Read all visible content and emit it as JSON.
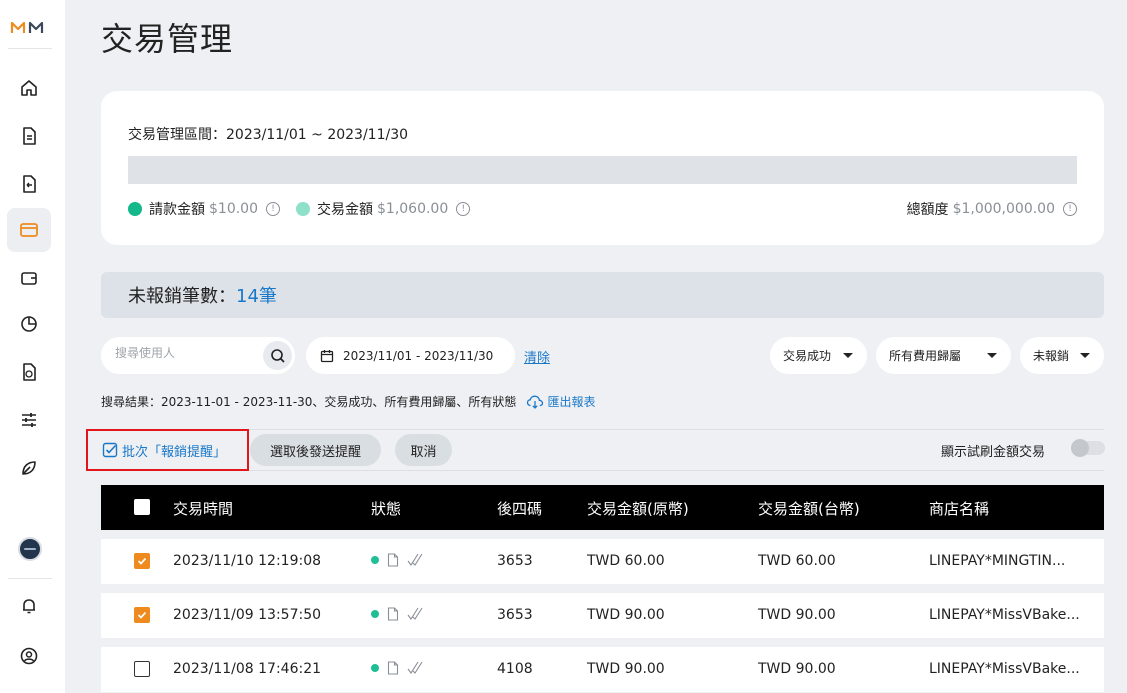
{
  "app": {
    "logo_text": "MM"
  },
  "page": {
    "title": "交易管理"
  },
  "summary": {
    "period_label": "交易管理區間：2023/11/01 ~ 2023/11/30",
    "claim_label": "請款金額",
    "claim_amount": "$10.00",
    "claim_color": "#14b88a",
    "tx_label": "交易金額",
    "tx_amount": "$1,060.00",
    "tx_color": "#8fe0c8",
    "limit_label": "總額度",
    "limit_amount": "$1,000,000.00",
    "info_glyph": "!"
  },
  "pending": {
    "label": "未報銷筆數：",
    "count": "14筆"
  },
  "filters": {
    "search_placeholder": "搜尋使用人",
    "search_value": "",
    "date_range": "2023/11/01 - 2023/11/30",
    "clear_label": "清除",
    "status_select": "交易成功",
    "category_select": "所有費用歸屬",
    "reimburse_select": "未報銷"
  },
  "results": {
    "text": "搜尋結果：2023-11-01 - 2023-11-30、交易成功、所有費用歸屬、所有狀態",
    "export_label": "匯出報表"
  },
  "actions": {
    "batch_label": "批次「報銷提醒」",
    "send_label": "選取後發送提醒",
    "cancel_label": "取消",
    "toggle_label": "顯示試刷金額交易",
    "toggle_on": false
  },
  "table": {
    "columns": [
      "交易時間",
      "狀態",
      "後四碼",
      "交易金額(原幣)",
      "交易金額(台幣)",
      "商店名稱"
    ],
    "rows": [
      {
        "checked": true,
        "time": "2023/11/10 12:19:08",
        "last4": "3653",
        "amount_orig": "TWD 60.00",
        "amount_twd": "TWD 60.00",
        "merchant": "LINEPAY*MINGTIN..."
      },
      {
        "checked": true,
        "time": "2023/11/09 13:57:50",
        "last4": "3653",
        "amount_orig": "TWD 90.00",
        "amount_twd": "TWD 90.00",
        "merchant": "LINEPAY*MissVBake..."
      },
      {
        "checked": false,
        "time": "2023/11/08 17:46:21",
        "last4": "4108",
        "amount_orig": "TWD 90.00",
        "amount_twd": "TWD 90.00",
        "merchant": "LINEPAY*MissVBake..."
      }
    ]
  },
  "sidebar": {
    "items": [
      {
        "icon": "home-icon"
      },
      {
        "icon": "document-icon"
      },
      {
        "icon": "document-return-icon"
      },
      {
        "icon": "credit-card-icon",
        "active": true
      },
      {
        "icon": "wallet-icon"
      },
      {
        "icon": "pie-chart-icon"
      },
      {
        "icon": "money-file-icon"
      },
      {
        "icon": "sliders-icon"
      },
      {
        "icon": "leaf-icon"
      }
    ],
    "bottom": [
      {
        "icon": "bell-icon"
      },
      {
        "icon": "user-circle-icon"
      }
    ]
  }
}
